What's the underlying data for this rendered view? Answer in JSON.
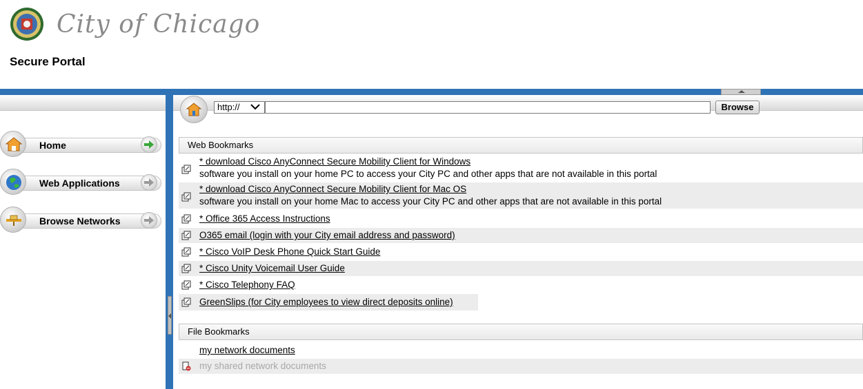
{
  "header": {
    "logo_text": "City of Chicago",
    "portal_title": "Secure Portal"
  },
  "sidebar": {
    "items": [
      {
        "label": "Home",
        "icon": "home-icon"
      },
      {
        "label": "Web Applications",
        "icon": "globe-icon"
      },
      {
        "label": "Browse Networks",
        "icon": "network-icon"
      }
    ]
  },
  "urlbar": {
    "protocol": "http://",
    "url_value": "",
    "browse_label": "Browse"
  },
  "web_bookmarks": {
    "title": "Web Bookmarks",
    "items": [
      {
        "label": "* download Cisco AnyConnect Secure Mobility Client for Windows",
        "desc": "software you install on your home PC to access your City PC and other apps that are not available in this portal"
      },
      {
        "label": "* download Cisco AnyConnect Secure Mobility Client for Mac OS",
        "desc": "software you install on your home Mac to access your City PC and other apps that are not available in this portal"
      },
      {
        "label": "* Office 365 Access Instructions"
      },
      {
        "label": "O365 email (login with your City email address and password)"
      },
      {
        "label": "* Cisco VoIP Desk Phone Quick Start Guide"
      },
      {
        "label": "* Cisco Unity Voicemail User Guide"
      },
      {
        "label": "* Cisco Telephony FAQ"
      },
      {
        "label": "GreenSlips (for City employees to view direct deposits online)",
        "highlighted": true
      }
    ]
  },
  "file_bookmarks": {
    "title": "File Bookmarks",
    "items": [
      {
        "label": "my network documents"
      },
      {
        "label": "my shared network documents",
        "disabled": true
      }
    ]
  },
  "colors": {
    "accent_blue": "#2f73b6",
    "highlight_yellow": "#f4f400"
  }
}
